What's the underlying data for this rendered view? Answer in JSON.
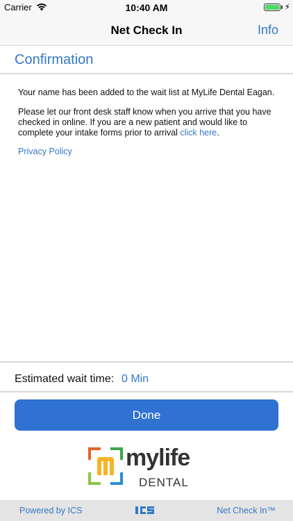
{
  "status_bar": {
    "carrier": "Carrier",
    "time": "10:40 AM",
    "battery_level": 1.0
  },
  "nav": {
    "title": "Net Check In",
    "info_label": "Info"
  },
  "confirmation": {
    "title": "Confirmation",
    "line1": "Your name has been added to the wait list at MyLife Dental Eagan.",
    "line2": "Please let our front desk staff know when you arrive that you have checked in online. If you are a new patient and would like to complete your intake forms prior to arrival ",
    "link_text": "click here",
    "line2_end": ".",
    "privacy_label": "Privacy Policy"
  },
  "wait": {
    "label": "Estimated wait time:",
    "value": "0 Min"
  },
  "done_label": "Done",
  "logo": {
    "name": "mylife",
    "sub": "DENTAL"
  },
  "footer": {
    "left": "Powered by ICS",
    "center_icon": "ics-logo-icon",
    "right": "Net Check In™"
  },
  "colors": {
    "accent": "#3478c6",
    "button": "#2f72d1"
  }
}
